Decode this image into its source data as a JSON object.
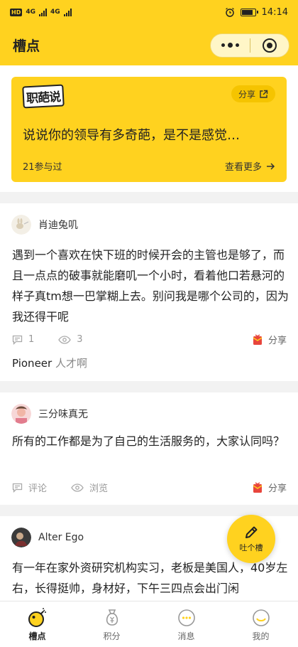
{
  "status_bar": {
    "network_badge": "HD",
    "signal_1": "4G",
    "signal_2": "4G",
    "time": "14:14"
  },
  "header": {
    "title": "槽点"
  },
  "banner": {
    "logo_text": "职葩说",
    "share_label": "分享",
    "title": "说说你的领导有多奇葩，是不是感觉…",
    "participants": "21参与过",
    "see_more": "查看更多"
  },
  "posts": [
    {
      "username": "肖迪兔叽",
      "text": "遇到一个喜欢在快下班的时候开会的主管也是够了，而且一点点的破事就能磨叽一个小时，看着他口若悬河的样子真tm想一巴掌糊上去。别问我是哪个公司的，因为我还得干呢",
      "comment_count": "1",
      "view_count": "3",
      "share_label": "分享",
      "top_comment_user": "Pioneer",
      "top_comment_text": "人才啊"
    },
    {
      "username": "三分味真无",
      "text": "所有的工作都是为了自己的生活服务的，大家认同吗？",
      "comment_label": "评论",
      "view_label": "浏览",
      "share_label": "分享"
    },
    {
      "username": "Alter Ego",
      "text": "有一年在家外资研究机构实习，老板是美国人，40岁左右，长得挺帅，身材好，下午三四点会出门闲"
    }
  ],
  "fab": {
    "label": "吐个槽"
  },
  "tabbar": {
    "items": [
      {
        "label": "槽点",
        "icon": "bomb-icon",
        "active": true
      },
      {
        "label": "积分",
        "icon": "coin-bag-icon",
        "active": false
      },
      {
        "label": "消息",
        "icon": "message-icon",
        "active": false
      },
      {
        "label": "我的",
        "icon": "smiley-icon",
        "active": false
      }
    ]
  },
  "colors": {
    "brand_yellow": "#ffd21f",
    "share_red": "#e8453c"
  }
}
